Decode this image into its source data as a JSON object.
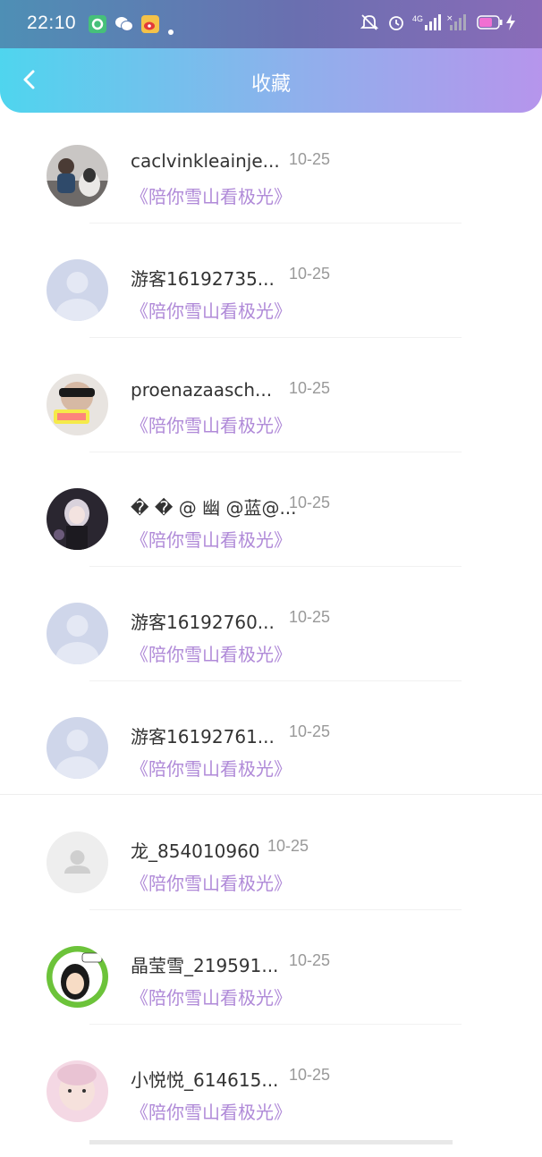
{
  "status_bar": {
    "time": "22:10",
    "network": "4G",
    "battery": "60",
    "icons": [
      "app-icon-green",
      "wechat-icon",
      "weibo-icon",
      "notification-dot",
      "mute-bell-icon",
      "alarm-icon",
      "signal-icon",
      "signal-icon-2",
      "battery-icon",
      "charging-icon"
    ]
  },
  "header": {
    "title": "收藏",
    "back_icon": "chevron-left-icon"
  },
  "favorites": [
    {
      "name": "caclvinkleainje...",
      "date": "10-25",
      "song": "《陪你雪山看极光》",
      "avatar": "photo-child-dog"
    },
    {
      "name": "游客16192735...",
      "date": "10-25",
      "song": "《陪你雪山看极光》",
      "avatar": "default-person"
    },
    {
      "name": "proenazaasch...",
      "date": "10-25",
      "song": "《陪你雪山看极光》",
      "avatar": "photo-sunglasses"
    },
    {
      "name": "� � @ 幽 @蓝@...",
      "date": "10-25",
      "song": "《陪你雪山看极光》",
      "avatar": "anime-girl"
    },
    {
      "name": "游客16192760...",
      "date": "10-25",
      "song": "《陪你雪山看极光》",
      "avatar": "default-person"
    },
    {
      "name": "游客16192761...",
      "date": "10-25",
      "song": "《陪你雪山看极光》",
      "avatar": "default-person"
    },
    {
      "name": "龙_854010960",
      "date": "10-25",
      "song": "《陪你雪山看极光》",
      "avatar": "default-gray"
    },
    {
      "name": "晶莹雪_219591...",
      "date": "10-25",
      "song": "《陪你雪山看极光》",
      "avatar": "cartoon-girl"
    },
    {
      "name": "小悦悦_614615...",
      "date": "10-25",
      "song": "《陪你雪山看极光》",
      "avatar": "photo-baby"
    }
  ],
  "colors": {
    "header_gradient_start": "#4fd5ee",
    "header_gradient_end": "#b695ec",
    "song_color": "#b08ad8",
    "name_color": "#333333",
    "date_color": "#999999"
  }
}
